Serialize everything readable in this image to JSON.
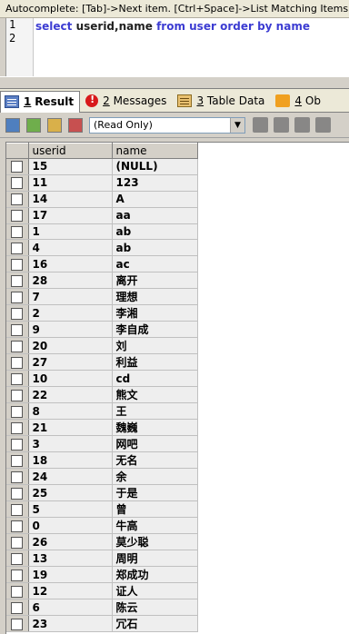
{
  "hint": "Autocomplete: [Tab]->Next item. [Ctrl+Space]->List Matching Items",
  "editor": {
    "line_numbers": [
      "1",
      "2"
    ],
    "tokens": {
      "select": "select",
      "fields": "userid,name",
      "from": "from",
      "table": "user",
      "order_by": "order by",
      "col": "name"
    }
  },
  "tabs": [
    {
      "num": "1",
      "label": "Result"
    },
    {
      "num": "2",
      "label": "Messages"
    },
    {
      "num": "3",
      "label": "Table Data"
    },
    {
      "num": "4",
      "label": "Ob"
    }
  ],
  "toolbar": {
    "mode_value": "(Read Only)"
  },
  "grid": {
    "columns": [
      "userid",
      "name"
    ],
    "rows": [
      [
        "15",
        "(NULL)"
      ],
      [
        "11",
        "123"
      ],
      [
        "14",
        "A"
      ],
      [
        "17",
        "aa"
      ],
      [
        "1",
        "ab"
      ],
      [
        "4",
        "ab"
      ],
      [
        "16",
        "ac"
      ],
      [
        "28",
        "离开"
      ],
      [
        "7",
        "理想"
      ],
      [
        "2",
        "李湘"
      ],
      [
        "9",
        "李自成"
      ],
      [
        "20",
        "刘"
      ],
      [
        "27",
        "利益"
      ],
      [
        "10",
        "cd"
      ],
      [
        "22",
        "熊文"
      ],
      [
        "8",
        "王"
      ],
      [
        "21",
        "魏巍"
      ],
      [
        "3",
        "网吧"
      ],
      [
        "18",
        "无名"
      ],
      [
        "24",
        "余"
      ],
      [
        "25",
        "于是"
      ],
      [
        "5",
        "曾"
      ],
      [
        "0",
        "牛高"
      ],
      [
        "26",
        "莫少聪"
      ],
      [
        "13",
        "周明"
      ],
      [
        "19",
        "郑成功"
      ],
      [
        "12",
        "证人"
      ],
      [
        "6",
        "陈云"
      ],
      [
        "23",
        "冗石"
      ]
    ]
  }
}
